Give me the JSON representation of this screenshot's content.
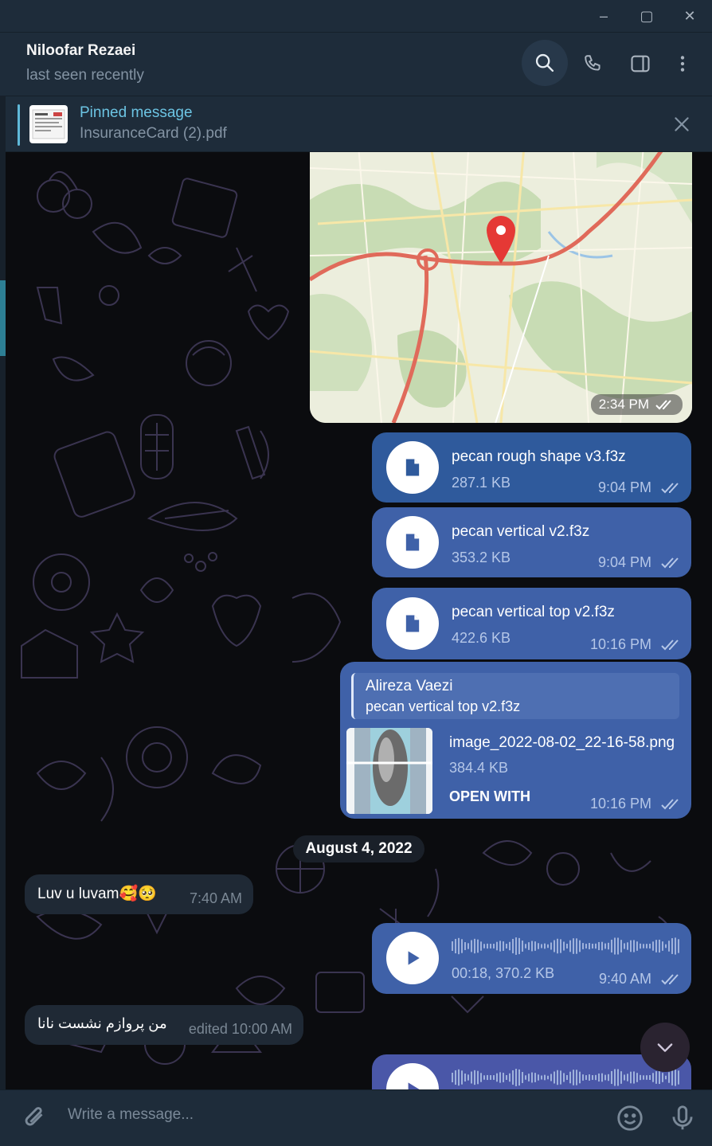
{
  "window": {
    "minimize": "–",
    "maximize": "▢",
    "close": "✕"
  },
  "header": {
    "name": "Niloofar Rezaei",
    "status": "last seen recently",
    "icons": [
      "search-icon",
      "phone-icon",
      "sidebar-toggle-icon",
      "more-vertical-icon"
    ]
  },
  "pinned": {
    "title": "Pinned message",
    "file": "InsuranceCard (2).pdf"
  },
  "messages": {
    "map": {
      "time": "2:34 PM"
    },
    "file1": {
      "name": "pecan rough shape v3.f3z",
      "size": "287.1 KB",
      "time": "9:04 PM"
    },
    "file2": {
      "name": "pecan vertical v2.f3z",
      "size": "353.2 KB",
      "time": "9:04 PM"
    },
    "file3": {
      "name": "pecan vertical top v2.f3z",
      "size": "422.6 KB",
      "time": "10:16 PM"
    },
    "reply": {
      "reply_name": "Alireza Vaezi",
      "reply_text": "pecan vertical top v2.f3z",
      "image_name": "image_2022-08-02_22-16-58.png",
      "image_size": "384.4 KB",
      "open_with": "OPEN WITH",
      "time": "10:16 PM"
    },
    "date": "August 4, 2022",
    "incoming1": {
      "text": "Luv u luvam🥰🥺",
      "time": "7:40 AM"
    },
    "voice1": {
      "meta": "00:18, 370.2 KB",
      "time": "9:40 AM"
    },
    "incoming2": {
      "text": "من پروازم نشست نانا",
      "time": "edited 10:00 AM"
    }
  },
  "composer": {
    "placeholder": "Write a message..."
  },
  "colors": {
    "outgoing": "#3f61a8",
    "incoming": "#1f2935",
    "accent": "#6cc4e3",
    "header": "#1e2c3a"
  }
}
